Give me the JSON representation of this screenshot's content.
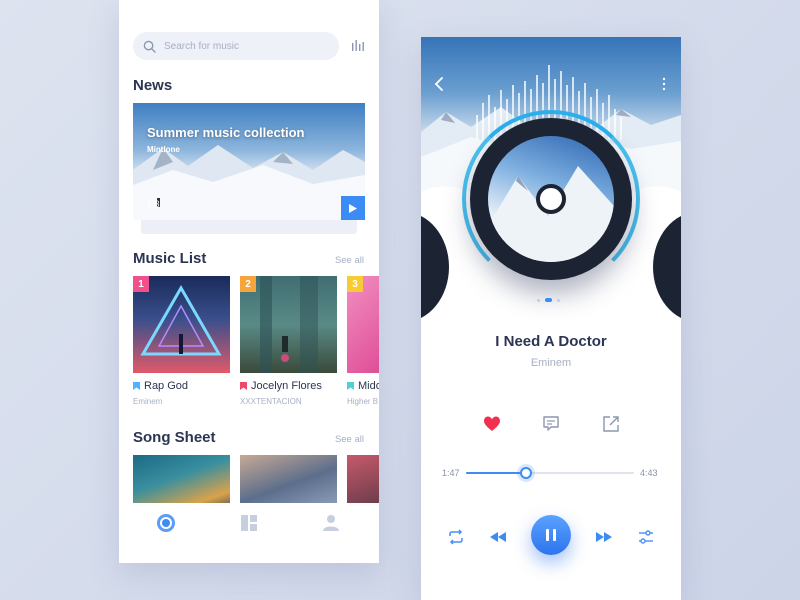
{
  "left": {
    "search": {
      "placeholder": "Search for music"
    },
    "news": {
      "title": "News",
      "banner_title": "Summer music collection",
      "banner_subtitle": "Mintlone",
      "page_indicator": "1/3"
    },
    "music_list": {
      "title": "Music List",
      "see_all": "See all",
      "items": [
        {
          "rank": "1",
          "name": "Rap God",
          "artist": "Eminem",
          "badge_color": "#f1508d",
          "icon_color": "#4fb4ff"
        },
        {
          "rank": "2",
          "name": "Jocelyn Flores",
          "artist": "XXXTENTACION",
          "badge_color": "#f5a53b",
          "icon_color": "#f0476d"
        },
        {
          "rank": "3",
          "name": "Mido",
          "artist": "Higher B",
          "badge_color": "#f6cb33",
          "icon_color": "#4fd0d8"
        }
      ]
    },
    "song_sheet": {
      "title": "Song Sheet",
      "see_all": "See all"
    },
    "tabs": [
      "music-disc-icon",
      "dashboard-icon",
      "profile-icon"
    ]
  },
  "player": {
    "track_title": "I Need A Doctor",
    "artist": "Eminem",
    "current_time": "1:47",
    "total_time": "4:43",
    "progress": 0.36,
    "liked": true,
    "accent": "#3d8bf4",
    "like_color": "#f0304e",
    "carousel_active_index": 1
  }
}
